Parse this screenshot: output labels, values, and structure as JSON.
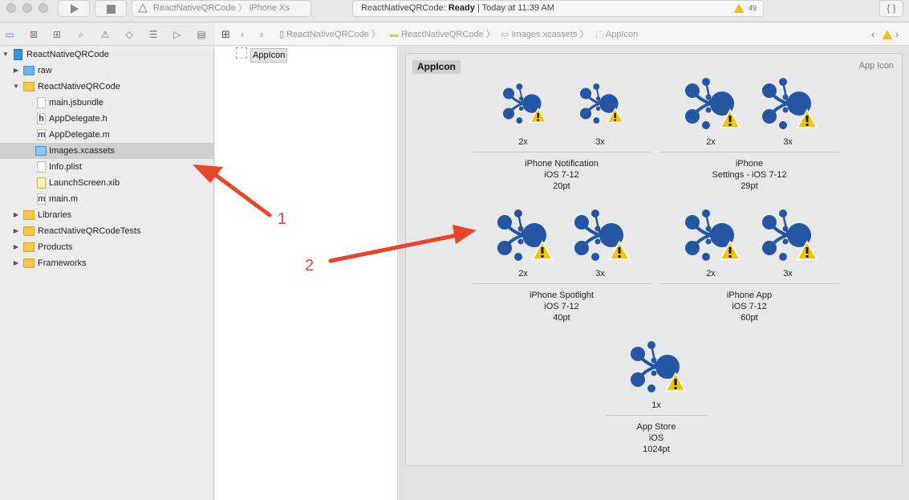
{
  "toolbar": {
    "scheme_target": "ReactNativeQRCode",
    "scheme_device": "iPhone Xs",
    "activity_project": "ReactNativeQRCode:",
    "activity_status": "Ready",
    "activity_time": "| Today at 11:39 AM",
    "warning_count": "49",
    "braces_label": "{ }"
  },
  "navigator": {
    "items": [
      {
        "label": "ReactNativeQRCode",
        "icon": "project-icon"
      },
      {
        "label": "raw",
        "icon": "folder-blue-icon"
      },
      {
        "label": "ReactNativeQRCode",
        "icon": "folder-yellow-icon"
      },
      {
        "label": "main.jsbundle",
        "icon": "document-icon"
      },
      {
        "label": "AppDelegate.h",
        "icon": "header-file-icon",
        "letter": "h"
      },
      {
        "label": "AppDelegate.m",
        "icon": "implementation-file-icon",
        "letter": "m"
      },
      {
        "label": "Images.xcassets",
        "icon": "asset-catalog-icon"
      },
      {
        "label": "Info.plist",
        "icon": "plist-icon"
      },
      {
        "label": "LaunchScreen.xib",
        "icon": "xib-icon"
      },
      {
        "label": "main.m",
        "icon": "implementation-file-icon",
        "letter": "m"
      },
      {
        "label": "Libraries",
        "icon": "folder-yellow-icon"
      },
      {
        "label": "ReactNativeQRCodeTests",
        "icon": "folder-yellow-icon"
      },
      {
        "label": "Products",
        "icon": "folder-yellow-icon"
      },
      {
        "label": "Frameworks",
        "icon": "folder-yellow-icon"
      }
    ]
  },
  "jumpbar": {
    "crumbs": [
      "ReactNativeQRCode",
      "ReactNativeQRCode",
      "Images.xcassets",
      "AppIcon"
    ]
  },
  "assetlist": {
    "selected": "AppIcon"
  },
  "editor": {
    "set_name": "AppIcon",
    "set_kind": "App Icon",
    "groups": [
      {
        "line1": "iPhone Notification",
        "line2": "iOS 7-12",
        "line3": "20pt",
        "scales": [
          "2x",
          "3x"
        ]
      },
      {
        "line1": "iPhone",
        "line2": "Settings - iOS 7-12",
        "line3": "29pt",
        "scales": [
          "2x",
          "3x"
        ]
      },
      {
        "line1": "iPhone Spotlight",
        "line2": "iOS 7-12",
        "line3": "40pt",
        "scales": [
          "2x",
          "3x"
        ]
      },
      {
        "line1": "iPhone App",
        "line2": "iOS 7-12",
        "line3": "60pt",
        "scales": [
          "2x",
          "3x"
        ]
      },
      {
        "line1": "App Store",
        "line2": "iOS",
        "line3": "1024pt",
        "scales": [
          "1x"
        ]
      }
    ]
  },
  "annotations": {
    "arrow1": "1",
    "arrow2": "2"
  },
  "colors": {
    "icon_blue": "#2556a3",
    "warning_yellow": "#f5c400",
    "annotation_red": "#e8452a"
  }
}
